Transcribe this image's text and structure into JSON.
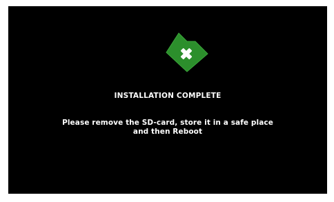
{
  "screen": {
    "background": "#000000",
    "accent": "#2c8f2c"
  },
  "icon": {
    "name": "sd-card-remove-icon"
  },
  "title": "INSTALLATION COMPLETE",
  "message": {
    "line1": "Please remove the SD-card, store it in a safe place",
    "line2": "and then Reboot"
  }
}
